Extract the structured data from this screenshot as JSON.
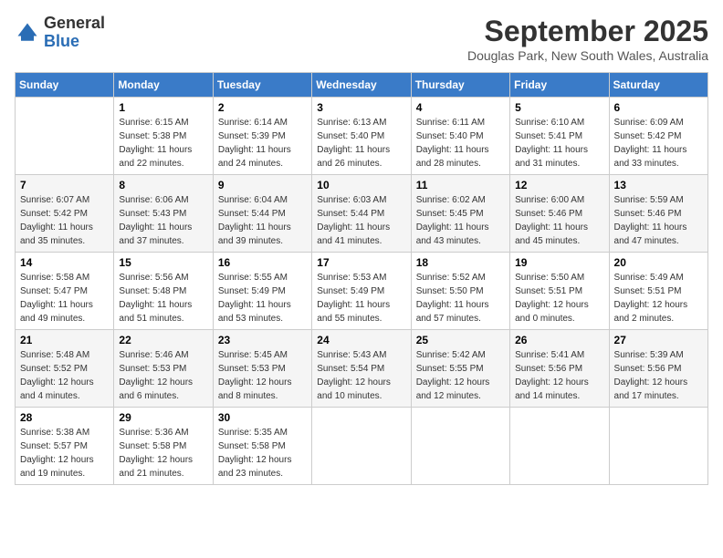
{
  "header": {
    "logo_general": "General",
    "logo_blue": "Blue",
    "month_title": "September 2025",
    "location": "Douglas Park, New South Wales, Australia"
  },
  "days_of_week": [
    "Sunday",
    "Monday",
    "Tuesday",
    "Wednesday",
    "Thursday",
    "Friday",
    "Saturday"
  ],
  "weeks": [
    [
      {
        "day": "",
        "sunrise": "",
        "sunset": "",
        "daylight": ""
      },
      {
        "day": "1",
        "sunrise": "Sunrise: 6:15 AM",
        "sunset": "Sunset: 5:38 PM",
        "daylight": "Daylight: 11 hours and 22 minutes."
      },
      {
        "day": "2",
        "sunrise": "Sunrise: 6:14 AM",
        "sunset": "Sunset: 5:39 PM",
        "daylight": "Daylight: 11 hours and 24 minutes."
      },
      {
        "day": "3",
        "sunrise": "Sunrise: 6:13 AM",
        "sunset": "Sunset: 5:40 PM",
        "daylight": "Daylight: 11 hours and 26 minutes."
      },
      {
        "day": "4",
        "sunrise": "Sunrise: 6:11 AM",
        "sunset": "Sunset: 5:40 PM",
        "daylight": "Daylight: 11 hours and 28 minutes."
      },
      {
        "day": "5",
        "sunrise": "Sunrise: 6:10 AM",
        "sunset": "Sunset: 5:41 PM",
        "daylight": "Daylight: 11 hours and 31 minutes."
      },
      {
        "day": "6",
        "sunrise": "Sunrise: 6:09 AM",
        "sunset": "Sunset: 5:42 PM",
        "daylight": "Daylight: 11 hours and 33 minutes."
      }
    ],
    [
      {
        "day": "7",
        "sunrise": "Sunrise: 6:07 AM",
        "sunset": "Sunset: 5:42 PM",
        "daylight": "Daylight: 11 hours and 35 minutes."
      },
      {
        "day": "8",
        "sunrise": "Sunrise: 6:06 AM",
        "sunset": "Sunset: 5:43 PM",
        "daylight": "Daylight: 11 hours and 37 minutes."
      },
      {
        "day": "9",
        "sunrise": "Sunrise: 6:04 AM",
        "sunset": "Sunset: 5:44 PM",
        "daylight": "Daylight: 11 hours and 39 minutes."
      },
      {
        "day": "10",
        "sunrise": "Sunrise: 6:03 AM",
        "sunset": "Sunset: 5:44 PM",
        "daylight": "Daylight: 11 hours and 41 minutes."
      },
      {
        "day": "11",
        "sunrise": "Sunrise: 6:02 AM",
        "sunset": "Sunset: 5:45 PM",
        "daylight": "Daylight: 11 hours and 43 minutes."
      },
      {
        "day": "12",
        "sunrise": "Sunrise: 6:00 AM",
        "sunset": "Sunset: 5:46 PM",
        "daylight": "Daylight: 11 hours and 45 minutes."
      },
      {
        "day": "13",
        "sunrise": "Sunrise: 5:59 AM",
        "sunset": "Sunset: 5:46 PM",
        "daylight": "Daylight: 11 hours and 47 minutes."
      }
    ],
    [
      {
        "day": "14",
        "sunrise": "Sunrise: 5:58 AM",
        "sunset": "Sunset: 5:47 PM",
        "daylight": "Daylight: 11 hours and 49 minutes."
      },
      {
        "day": "15",
        "sunrise": "Sunrise: 5:56 AM",
        "sunset": "Sunset: 5:48 PM",
        "daylight": "Daylight: 11 hours and 51 minutes."
      },
      {
        "day": "16",
        "sunrise": "Sunrise: 5:55 AM",
        "sunset": "Sunset: 5:49 PM",
        "daylight": "Daylight: 11 hours and 53 minutes."
      },
      {
        "day": "17",
        "sunrise": "Sunrise: 5:53 AM",
        "sunset": "Sunset: 5:49 PM",
        "daylight": "Daylight: 11 hours and 55 minutes."
      },
      {
        "day": "18",
        "sunrise": "Sunrise: 5:52 AM",
        "sunset": "Sunset: 5:50 PM",
        "daylight": "Daylight: 11 hours and 57 minutes."
      },
      {
        "day": "19",
        "sunrise": "Sunrise: 5:50 AM",
        "sunset": "Sunset: 5:51 PM",
        "daylight": "Daylight: 12 hours and 0 minutes."
      },
      {
        "day": "20",
        "sunrise": "Sunrise: 5:49 AM",
        "sunset": "Sunset: 5:51 PM",
        "daylight": "Daylight: 12 hours and 2 minutes."
      }
    ],
    [
      {
        "day": "21",
        "sunrise": "Sunrise: 5:48 AM",
        "sunset": "Sunset: 5:52 PM",
        "daylight": "Daylight: 12 hours and 4 minutes."
      },
      {
        "day": "22",
        "sunrise": "Sunrise: 5:46 AM",
        "sunset": "Sunset: 5:53 PM",
        "daylight": "Daylight: 12 hours and 6 minutes."
      },
      {
        "day": "23",
        "sunrise": "Sunrise: 5:45 AM",
        "sunset": "Sunset: 5:53 PM",
        "daylight": "Daylight: 12 hours and 8 minutes."
      },
      {
        "day": "24",
        "sunrise": "Sunrise: 5:43 AM",
        "sunset": "Sunset: 5:54 PM",
        "daylight": "Daylight: 12 hours and 10 minutes."
      },
      {
        "day": "25",
        "sunrise": "Sunrise: 5:42 AM",
        "sunset": "Sunset: 5:55 PM",
        "daylight": "Daylight: 12 hours and 12 minutes."
      },
      {
        "day": "26",
        "sunrise": "Sunrise: 5:41 AM",
        "sunset": "Sunset: 5:56 PM",
        "daylight": "Daylight: 12 hours and 14 minutes."
      },
      {
        "day": "27",
        "sunrise": "Sunrise: 5:39 AM",
        "sunset": "Sunset: 5:56 PM",
        "daylight": "Daylight: 12 hours and 17 minutes."
      }
    ],
    [
      {
        "day": "28",
        "sunrise": "Sunrise: 5:38 AM",
        "sunset": "Sunset: 5:57 PM",
        "daylight": "Daylight: 12 hours and 19 minutes."
      },
      {
        "day": "29",
        "sunrise": "Sunrise: 5:36 AM",
        "sunset": "Sunset: 5:58 PM",
        "daylight": "Daylight: 12 hours and 21 minutes."
      },
      {
        "day": "30",
        "sunrise": "Sunrise: 5:35 AM",
        "sunset": "Sunset: 5:58 PM",
        "daylight": "Daylight: 12 hours and 23 minutes."
      },
      {
        "day": "",
        "sunrise": "",
        "sunset": "",
        "daylight": ""
      },
      {
        "day": "",
        "sunrise": "",
        "sunset": "",
        "daylight": ""
      },
      {
        "day": "",
        "sunrise": "",
        "sunset": "",
        "daylight": ""
      },
      {
        "day": "",
        "sunrise": "",
        "sunset": "",
        "daylight": ""
      }
    ]
  ]
}
